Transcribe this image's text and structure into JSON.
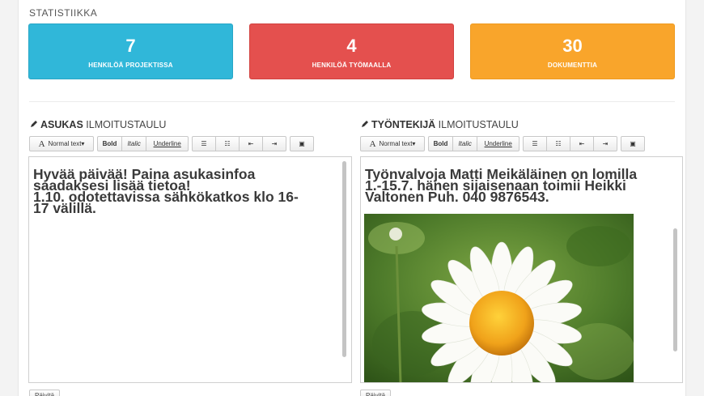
{
  "section": {
    "title": "STATISTIIKKA"
  },
  "stats": [
    {
      "value": "7",
      "label": "HENKILÖÄ PROJEKTISSA",
      "color": "#30b7d9"
    },
    {
      "value": "4",
      "label": "HENKILÖÄ TYÖMAALLA",
      "color": "#e4504e"
    },
    {
      "value": "30",
      "label": "DOKUMENTTIA",
      "color": "#f9a52b"
    }
  ],
  "boards": {
    "left": {
      "title_bold": "ASUKAS",
      "title_light": "ILMOITUSTAULU",
      "content": "Hyvää päivää! Paina asukasinfoa\nsaadaksesi lisää tietoa!\n1.10. odotettavissa sähkökatkos klo 16-\n17 välillä.",
      "save_label": "Päivitä"
    },
    "right": {
      "title_bold": "TYÖNTEKIJÄ",
      "title_light": "ILMOITUSTAULU",
      "content": " Työnvalvoja Matti Meikäläinen on lomilla\n1.-15.7. hänen sijaisenaan toimii Heikki\nValtonen Puh. 040 9876543.",
      "save_label": "Päivitä"
    }
  },
  "toolbar": {
    "text_style": "Normal text",
    "bold": "Bold",
    "italic": "Italic",
    "underline": "Underline",
    "icons": [
      "unordered-list-icon",
      "ordered-list-icon",
      "outdent-icon",
      "indent-icon",
      "image-icon"
    ]
  },
  "colors": {
    "accent_blue": "#30b7d9",
    "accent_red": "#e4504e",
    "accent_orange": "#f9a52b"
  }
}
